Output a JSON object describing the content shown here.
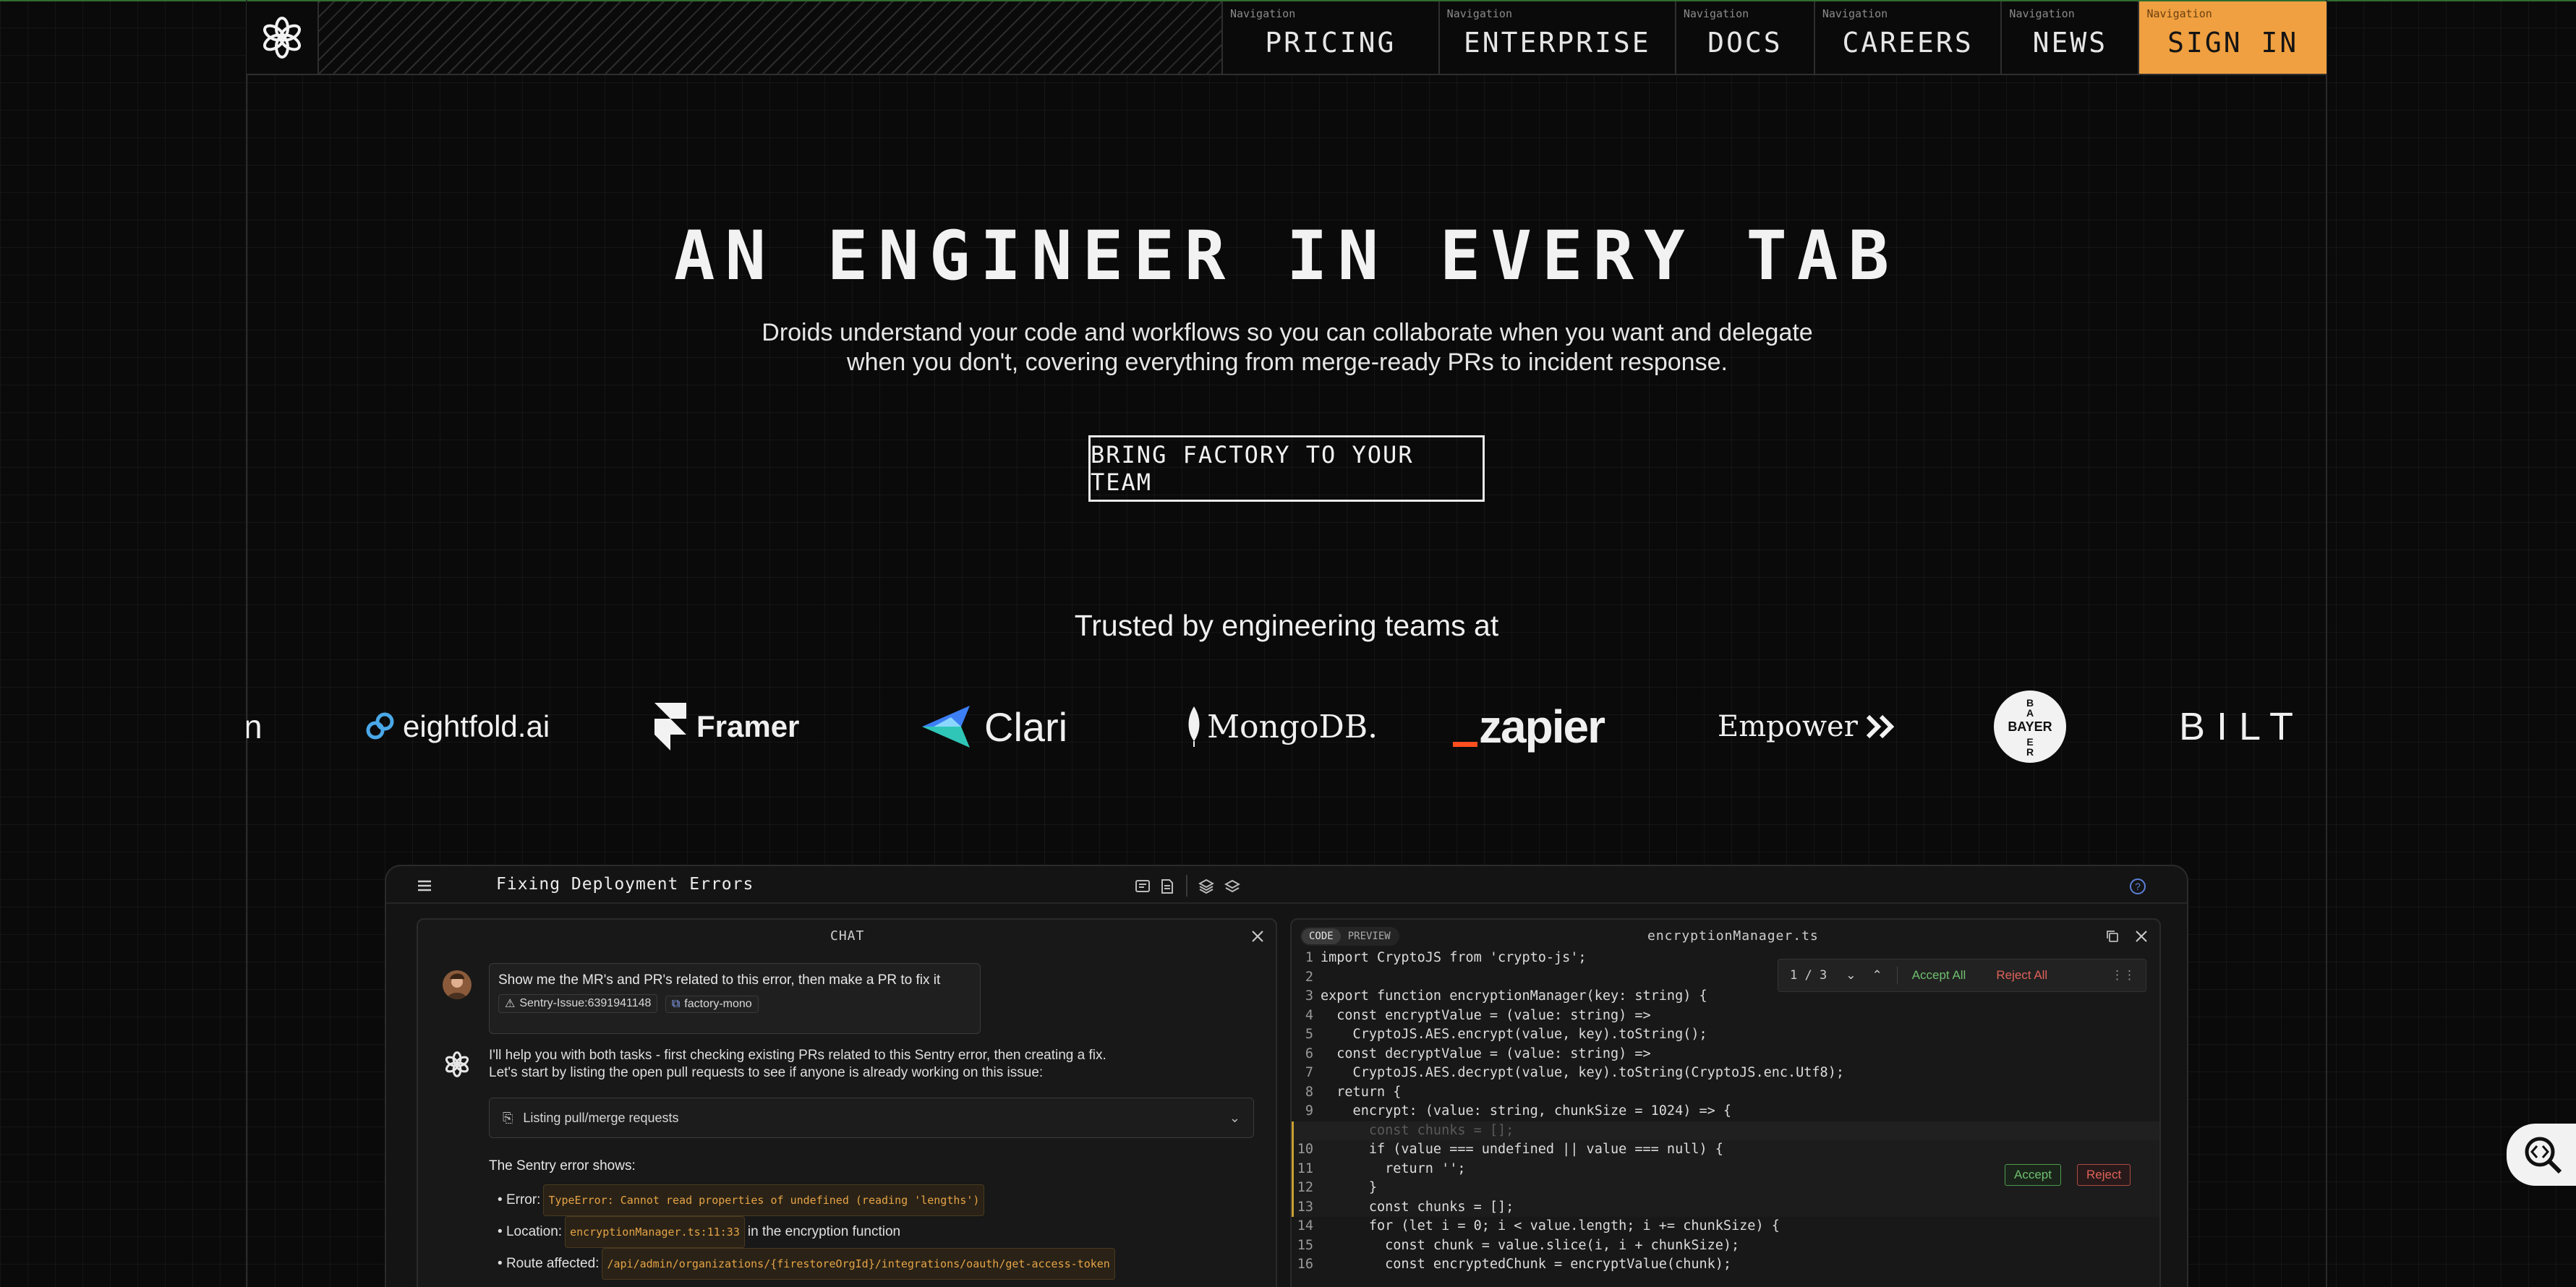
{
  "header": {
    "nav_tag": "Navigation",
    "nav": [
      {
        "label": "PRICING"
      },
      {
        "label": "ENTERPRISE"
      },
      {
        "label": "DOCS"
      },
      {
        "label": "CAREERS"
      },
      {
        "label": "NEWS"
      },
      {
        "label": "SIGN IN"
      }
    ]
  },
  "hero": {
    "title": "AN ENGINEER IN EVERY TAB",
    "subtitle_line1": "Droids understand your code and workflows so you can collaborate when you want and delegate",
    "subtitle_line2": "when you don't, covering everything from merge-ready PRs to incident response.",
    "cta": "BRING FACTORY TO YOUR TEAM"
  },
  "trusted": {
    "heading": "Trusted by engineering teams at",
    "logos": [
      "n",
      "eightfold.ai",
      "Framer",
      "Clari",
      "MongoDB.",
      "_zapier",
      "Empower",
      "BAYER",
      "BILT B"
    ]
  },
  "app": {
    "title": "Fixing Deployment Errors",
    "chat": {
      "header": "CHAT",
      "user_message": "Show me the MR's and PR's related to this error, then make a PR to fix it",
      "chip_issue": "Sentry-Issue:6391941148",
      "chip_repo": "factory-mono",
      "bot_line1": "I'll help you with both tasks - first checking existing PRs related to this Sentry error, then creating a fix.",
      "bot_line2": "Let's start by listing the open pull requests to see if anyone is already working on this issue:",
      "tool_call": "Listing pull/merge requests",
      "shows_heading": "The Sentry error shows:",
      "error_label": "Error:",
      "error_value": "TypeError: Cannot read properties of undefined  (reading 'lengths')",
      "location_label": "Location:",
      "location_value": "encryptionManager.ts:11:33",
      "location_suffix": "in the encryption function",
      "route_label": "Route affected:",
      "route_value": "/api/admin/organizations/{firestoreOrgId}/integrations/oauth/get-access-token"
    },
    "code": {
      "tab_code": "CODE",
      "tab_preview": "PREVIEW",
      "filename": "encryptionManager.ts",
      "diff_counter": "1 / 3",
      "accept_all": "Accept All",
      "reject_all": "Reject All",
      "accept": "Accept",
      "reject": "Reject",
      "lines": [
        {
          "n": "1",
          "text": "import CryptoJS from 'crypto-js';"
        },
        {
          "n": "2",
          "text": ""
        },
        {
          "n": "3",
          "text": "export function encryptionManager(key: string) {"
        },
        {
          "n": "4",
          "text": "  const encryptValue = (value: string) =>"
        },
        {
          "n": "5",
          "text": "    CryptoJS.AES.encrypt(value, key).toString();"
        },
        {
          "n": "6",
          "text": "  const decryptValue = (value: string) =>"
        },
        {
          "n": "7",
          "text": "    CryptoJS.AES.decrypt(value, key).toString(CryptoJS.enc.Utf8);"
        },
        {
          "n": "8",
          "text": "  return {"
        },
        {
          "n": "9",
          "text": "    encrypt: (value: string, chunkSize = 1024) => {"
        },
        {
          "n": "",
          "text": "      const chunks = [];"
        },
        {
          "n": "10",
          "text": "      if (value === undefined || value === null) {"
        },
        {
          "n": "11",
          "text": "        return '';"
        },
        {
          "n": "12",
          "text": "      }"
        },
        {
          "n": "13",
          "text": "      const chunks = [];"
        },
        {
          "n": "14",
          "text": "      for (let i = 0; i < value.length; i += chunkSize) {"
        },
        {
          "n": "15",
          "text": "        const chunk = value.slice(i, i + chunkSize);"
        },
        {
          "n": "16",
          "text": "        const encryptedChunk = encryptValue(chunk);"
        }
      ]
    }
  },
  "colors": {
    "accent": "#f0a040",
    "accept": "#6fbf6f",
    "reject": "#e0625a",
    "diff_bar": "#c8a030"
  }
}
